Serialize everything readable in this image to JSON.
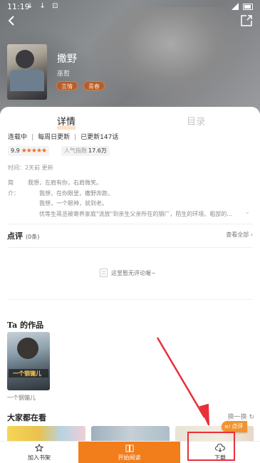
{
  "status_bar": {
    "time": "11:19",
    "icons": "↓ ↓ ⊡"
  },
  "header": {
    "title": "撒野",
    "author": "巫哲",
    "tags": [
      "言情",
      "青春"
    ]
  },
  "tabs": {
    "details": "详情",
    "catalog": "目录"
  },
  "info": {
    "status": "连载中",
    "schedule": "每周日更新",
    "chapters": "已更新147话",
    "rating": "9.9",
    "stars": "★★★★★",
    "popularity_label": "人气指数",
    "popularity_value": "17.6万",
    "update_time": "时间：2天前 更新"
  },
  "synopsis": {
    "label": "简介：",
    "lines": [
      "我想，左肩有你，右肩微笑。",
      "我想，在你眼里，撒野奔跑，",
      "我想，一个眼神，就到老。",
      "优等生蒋丞被寄养家庭\"流放\"到亲生父亲所在的钢厂，陌生的环境、粗部的..."
    ]
  },
  "comments": {
    "title": "点评",
    "count": "(0条)",
    "see_all": "查看全部",
    "empty": "这里暂无评论喔~"
  },
  "author_works": {
    "title": "Ta 的作品",
    "work_name": "一个钢镚儿",
    "cover_text": "一个钢镚儿"
  },
  "everyone_watching": {
    "title": "大家都在看",
    "switch": "换一换"
  },
  "comment_fab": "点评",
  "bottom_bar": {
    "add_shelf": "加入书架",
    "start_reading": "开始阅读",
    "download": "下载"
  },
  "colors": {
    "accent": "#f27d1b",
    "annotation": "#e8303a",
    "star": "#f06a2a"
  }
}
